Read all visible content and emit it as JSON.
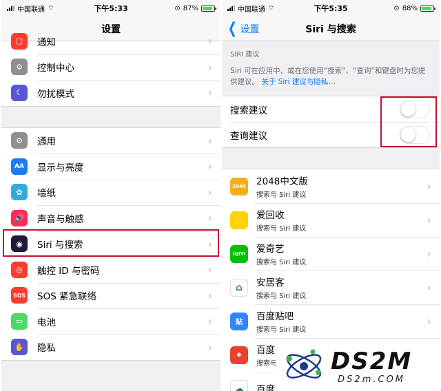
{
  "left_screen": {
    "status": {
      "carrier": "中国联通",
      "time": "下午5:33",
      "battery": "87%",
      "battery_level": 0.87
    },
    "nav_title": "设置",
    "group_top": [
      {
        "label": "通知",
        "icon": "notification-icon",
        "color": "#ff3b30",
        "glyph": "▢"
      },
      {
        "label": "控制中心",
        "icon": "control-center-icon",
        "color": "#8e8e93",
        "glyph": "⚙"
      },
      {
        "label": "勿扰模式",
        "icon": "moon-icon",
        "color": "#5856d6",
        "glyph": "☾"
      }
    ],
    "group_main": [
      {
        "label": "通用",
        "icon": "gear-icon",
        "color": "#8e8e93",
        "glyph": "⚙"
      },
      {
        "label": "显示与亮度",
        "icon": "display-icon",
        "color": "#1e7cf2",
        "glyph": "AA"
      },
      {
        "label": "墙纸",
        "icon": "wallpaper-icon",
        "color": "#34aadc",
        "glyph": "✿"
      },
      {
        "label": "声音与触感",
        "icon": "sound-icon",
        "color": "#ff2d55",
        "glyph": "🔊"
      },
      {
        "label": "Siri 与搜索",
        "icon": "siri-icon",
        "color": "#1c1c3a",
        "glyph": "◉"
      },
      {
        "label": "触控 ID 与密码",
        "icon": "fingerprint-icon",
        "color": "#ff3b30",
        "glyph": "◎"
      },
      {
        "label": "SOS 紧急联络",
        "icon": "sos-icon",
        "color": "#ff3b30",
        "glyph": "SOS"
      },
      {
        "label": "电池",
        "icon": "battery-icon",
        "color": "#4cd964",
        "glyph": "▭"
      },
      {
        "label": "隐私",
        "icon": "hand-icon",
        "color": "#5856d6",
        "glyph": "✋"
      }
    ]
  },
  "right_screen": {
    "status": {
      "carrier": "中国联通",
      "time": "下午5:35",
      "battery": "88%",
      "battery_level": 0.88
    },
    "back_label": "设置",
    "nav_title": "Siri 与搜索",
    "section_header": "SIRI 建议",
    "section_note": "Siri 可在应用中、或在您使用“搜索”、“查询”和键盘时为您提供建议。",
    "section_link": "关于 Siri 建议与隐私…",
    "toggles": [
      {
        "label": "搜索建议",
        "on": false
      },
      {
        "label": "查询建议",
        "on": false
      }
    ],
    "apps": [
      {
        "name": "2048中文版",
        "sub": "搜索与 Siri 建议",
        "icon": "app-2048-icon",
        "color": "#f2b01e",
        "glyph": "2048"
      },
      {
        "name": "爱回收",
        "sub": "搜索与 Siri 建议",
        "icon": "aihuishou-icon",
        "color": "#ffd200",
        "glyph": "♡"
      },
      {
        "name": "爱奇艺",
        "sub": "搜索与 Siri 建议",
        "icon": "iqiyi-icon",
        "color": "#00be06",
        "glyph": "iQIYI"
      },
      {
        "name": "安居客",
        "sub": "搜索与 Siri 建议",
        "icon": "anjuke-icon",
        "color": "#ffffff",
        "glyph": "⌂"
      },
      {
        "name": "百度贴吧",
        "sub": "搜索与 Siri 建议",
        "icon": "tieba-icon",
        "color": "#3385ff",
        "glyph": "贴"
      },
      {
        "name": "百度外卖",
        "sub": "搜索与 Siri 建议",
        "icon": "baidu-waimai-icon",
        "color": "#e8412c",
        "glyph": "◈"
      },
      {
        "name": "百度网盘",
        "sub": "",
        "icon": "baidu-netdisk-icon",
        "color": "#ffffff",
        "glyph": "☁"
      }
    ]
  },
  "watermark": {
    "brand": "DS2M",
    "site": "DS2m.COM"
  }
}
